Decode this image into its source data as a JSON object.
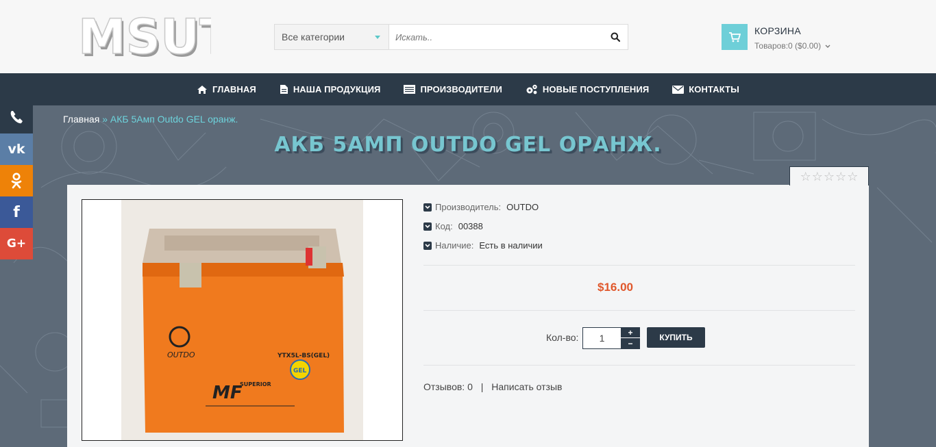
{
  "logo": {
    "text": "MSUT"
  },
  "search": {
    "category_selected": "Все категории",
    "placeholder": "Искать.."
  },
  "cart": {
    "title": "КОРЗИНА",
    "summary": "Товаров:0 ($0.00)"
  },
  "nav": {
    "items": [
      {
        "label": "ГЛАВНАЯ",
        "icon": "home-icon"
      },
      {
        "label": "НАША ПРОДУКЦИЯ",
        "icon": "document-icon"
      },
      {
        "label": "ПРОИЗВОДИТЕЛИ",
        "icon": "list-icon"
      },
      {
        "label": "НОВЫЕ ПОСТУПЛЕНИЯ",
        "icon": "gears-icon"
      },
      {
        "label": "КОНТАКТЫ",
        "icon": "envelope-icon"
      }
    ]
  },
  "social": [
    {
      "name": "phone-icon",
      "color": "#2c3a48"
    },
    {
      "name": "vk-icon",
      "color": "#5b7ea6"
    },
    {
      "name": "odnoklassniki-icon",
      "color": "#ee8208"
    },
    {
      "name": "facebook-icon",
      "color": "#3b5998"
    },
    {
      "name": "google-plus-icon",
      "color": "#dd4b39"
    }
  ],
  "breadcrumb": {
    "home": "Главная",
    "separator": "»",
    "current": "АКБ 5Амп Outdo GEL оранж."
  },
  "page_title": "АКБ 5Амп Outdo GEL оранж.",
  "rating": {
    "stars": 0,
    "max": 5
  },
  "product": {
    "image_labels": {
      "brand": "OUTDO",
      "model": "YTX5L-BS(GEL)",
      "series": "SUPERIOR",
      "mf": "MF",
      "gel": "GEL"
    },
    "specs": [
      {
        "label": "Производитель:",
        "value": "OUTDO"
      },
      {
        "label": "Код:",
        "value": "00388"
      },
      {
        "label": "Наличие:",
        "value": "Есть в наличии"
      }
    ],
    "price": "$16.00",
    "qty_label": "Кол-во:",
    "qty_value": "1",
    "buy_label": "КУПИТЬ",
    "reviews_count": "Отзывов: 0",
    "reviews_sep": "|",
    "write_review": "Написать отзыв"
  },
  "colors": {
    "nav_bg": "#2c3a48",
    "accent_teal": "#6ecfd8",
    "price": "#e0572b"
  }
}
